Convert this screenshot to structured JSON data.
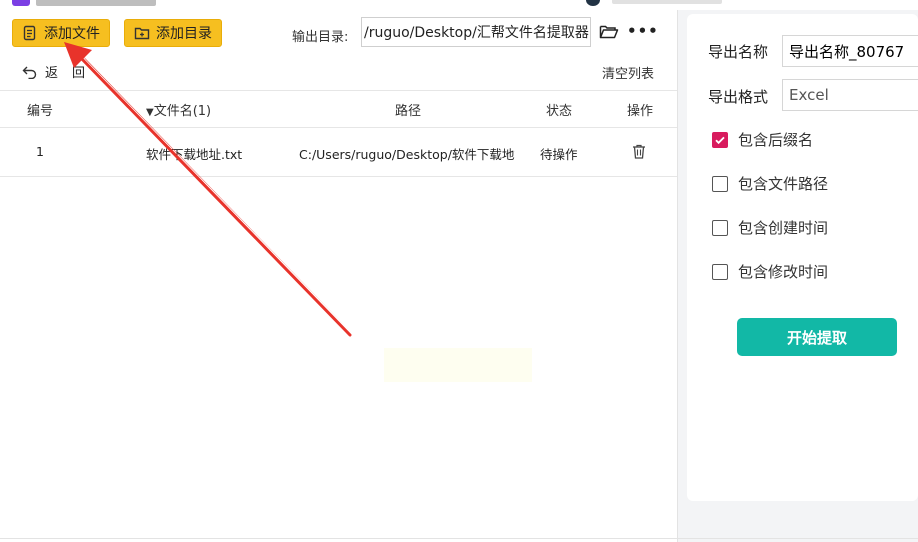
{
  "toolbar": {
    "add_file_label": "添加文件",
    "add_dir_label": "添加目录",
    "output_dir_label": "输出目录:",
    "output_dir_value": "/ruguo/Desktop/汇帮文件名提取器",
    "more_label": "•••"
  },
  "actions": {
    "back_label": "返回",
    "clear_label": "清空列表"
  },
  "table": {
    "headers": {
      "index": "编号",
      "name": "文件名(1)",
      "path": "路径",
      "status": "状态",
      "action": "操作"
    },
    "rows": [
      {
        "index": "1",
        "name": "软件下载地址.txt",
        "path": "C:/Users/ruguo/Desktop/软件下载地址",
        "status": "待操作"
      }
    ]
  },
  "settings": {
    "export_name_label": "导出名称",
    "export_name_value": "导出名称_80767",
    "export_format_label": "导出格式",
    "export_format_value": "Excel",
    "options": [
      {
        "label": "包含后缀名",
        "checked": true
      },
      {
        "label": "包含文件路径",
        "checked": false
      },
      {
        "label": "包含创建时间",
        "checked": false
      },
      {
        "label": "包含修改时间",
        "checked": false
      }
    ],
    "start_label": "开始提取"
  },
  "colors": {
    "button_yellow": "#f6bf20",
    "accent_teal": "#12b8a6",
    "checkbox_pink": "#d81b5e",
    "arrow_red": "#e8332b"
  }
}
